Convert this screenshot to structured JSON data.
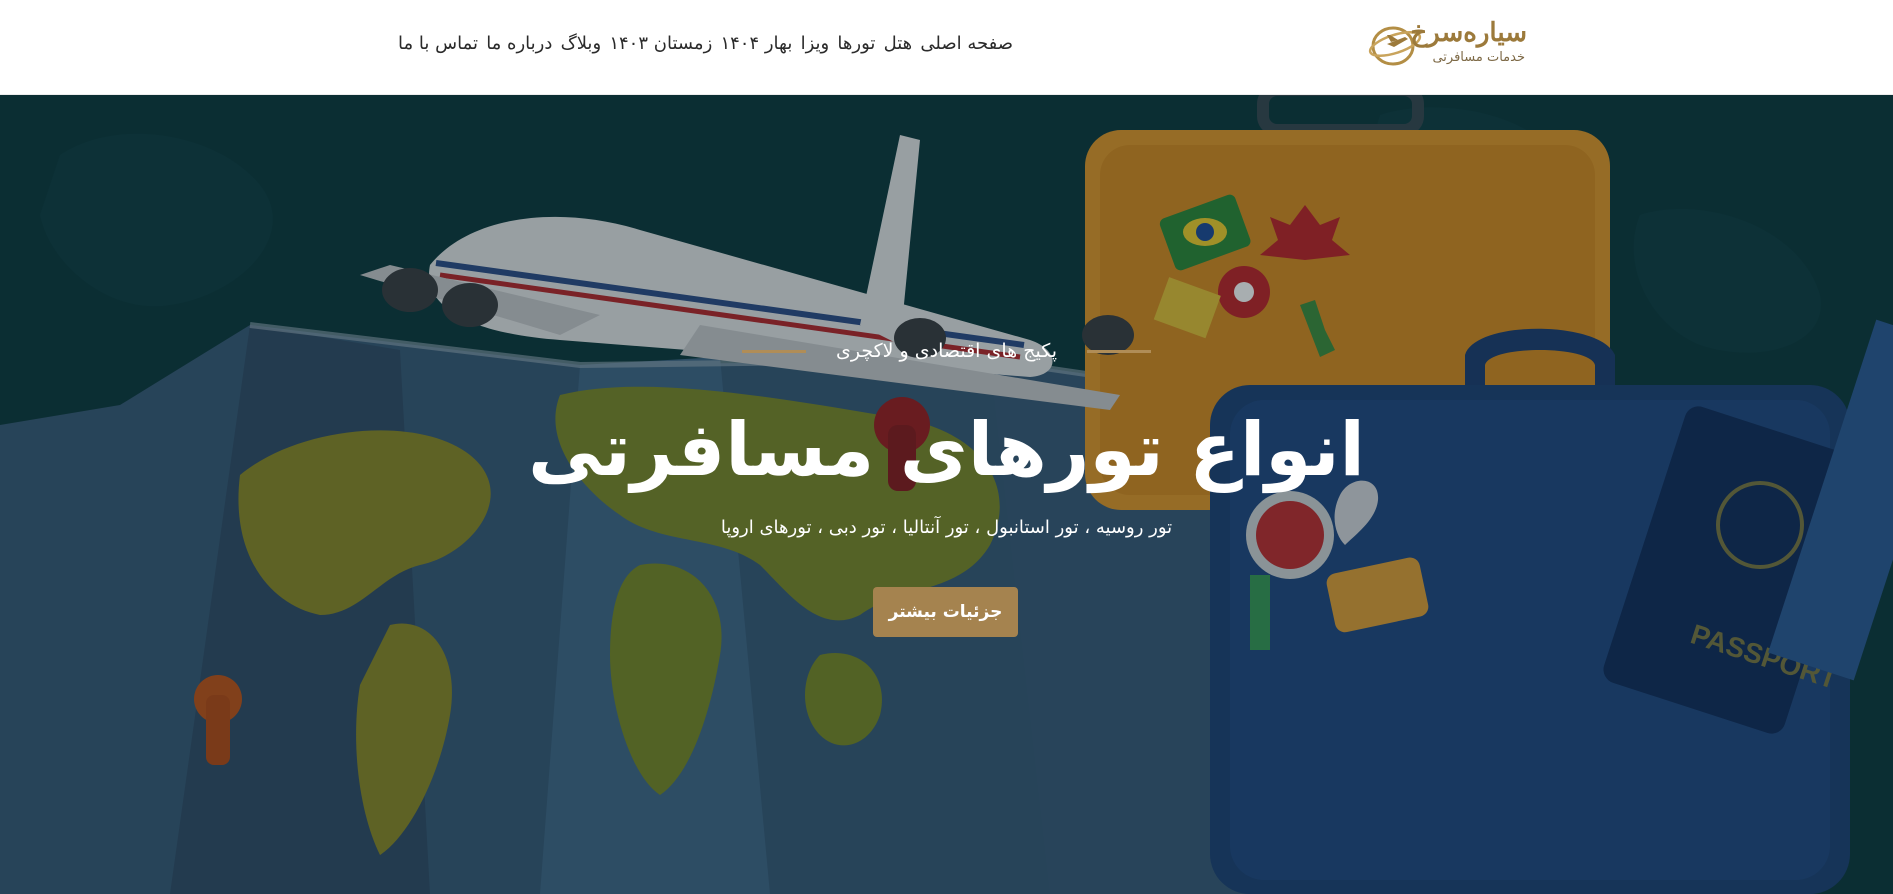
{
  "header": {
    "logo": {
      "title": "سیاره‌سرخ",
      "subtitle": "خدمات مسافرتی"
    },
    "nav": [
      "صفحه اصلی",
      "هتل",
      "تورها",
      "ویزا",
      "بهار ۱۴۰۴",
      "زمستان ۱۴۰۳",
      "وبلاگ",
      "درباره ما",
      "تماس با ما"
    ]
  },
  "hero": {
    "eyebrow": "پکیج های اقتصادی و لاکچری",
    "title": "انواع تورهای مسافرتی",
    "subtitle": "تور روسیه ، تور استانبول ، تور آنتالیا ، تور دبی ، تورهای اروپا",
    "cta_label": "جزئیات بیشتر",
    "passport_text": "PASSPORT"
  },
  "colors": {
    "accent": "#a5834f",
    "hero_bg": "#0f3b40",
    "suitcase": "#e39a2c",
    "map": "#2e4f6b"
  }
}
